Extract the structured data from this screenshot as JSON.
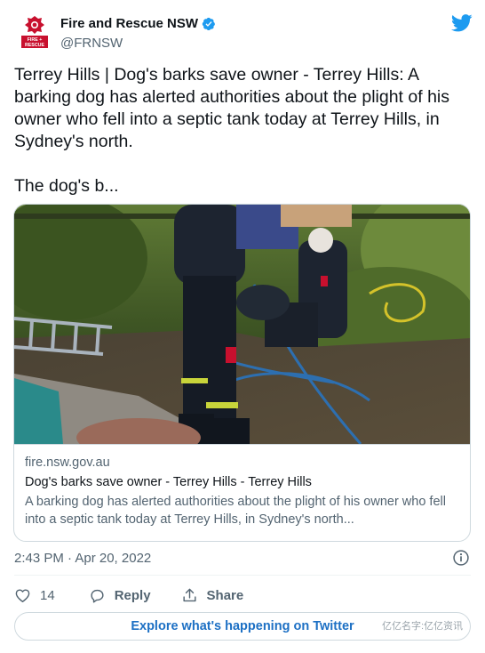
{
  "author": {
    "name": "Fire and Rescue NSW",
    "handle": "@FRNSW",
    "avatar_text": "FIRE+RESCUE",
    "verified": true
  },
  "tweet": {
    "text": "Terrey Hills | Dog's barks save owner - Terrey Hills: A barking dog has alerted authorities about the plight of his owner who fell into a septic tank today at Terrey Hills, in Sydney's north.\n\nThe dog's b..."
  },
  "card": {
    "domain": "fire.nsw.gov.au",
    "title": "Dog's barks save owner - Terrey Hills - Terrey Hills",
    "description": "A barking dog has alerted authorities about the plight of his owner who fell into a septic tank today at Terrey Hills, in Sydney's north..."
  },
  "meta": {
    "timestamp": "2:43 PM · Apr 20, 2022"
  },
  "actions": {
    "like_count": "14",
    "reply_label": "Reply",
    "share_label": "Share"
  },
  "explore_label": "Explore what's happening on Twitter",
  "watermark": "亿亿名字:亿亿资讯",
  "colors": {
    "brand_blue": "#1d9bf0",
    "link_blue": "#1d70c4",
    "secondary_text": "#536471",
    "border": "#cfd9de",
    "avatar_red": "#c8102e"
  },
  "icons": {
    "avatar": "fire-rescue-nsw-logo",
    "verified": "verified-badge-icon",
    "twitter": "twitter-bird-icon",
    "info": "info-icon",
    "like": "heart-icon",
    "reply": "speech-bubble-icon",
    "share": "share-upload-icon"
  }
}
